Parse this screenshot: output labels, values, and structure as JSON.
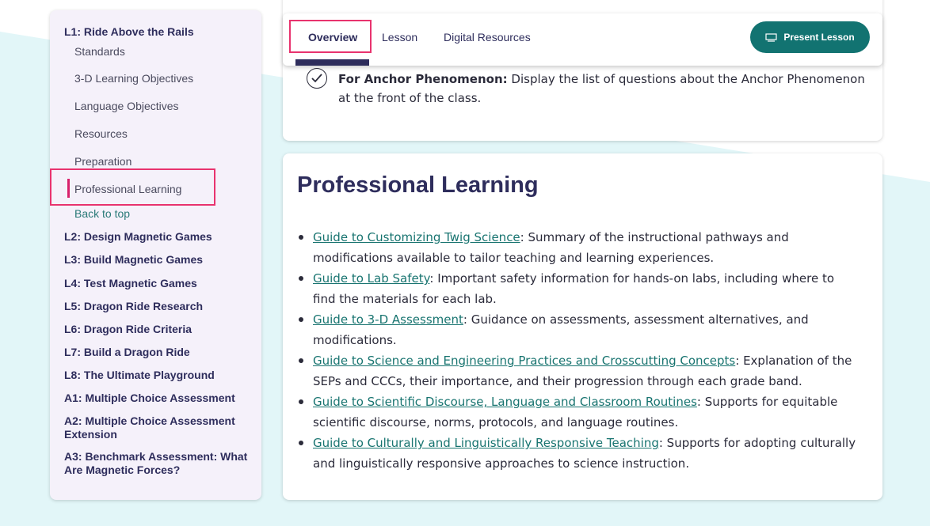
{
  "sidebar": {
    "top_item": "L1: Ride Above the Rails",
    "sub_items": [
      {
        "label": "Standards"
      },
      {
        "label": "3-D Learning Objectives"
      },
      {
        "label": "Language Objectives"
      },
      {
        "label": "Resources"
      },
      {
        "label": "Preparation"
      },
      {
        "label": "Professional Learning"
      }
    ],
    "back_to_top": "Back to top",
    "lessons": [
      {
        "label": "L2: Design Magnetic Games"
      },
      {
        "label": "L3: Build Magnetic Games"
      },
      {
        "label": "L4: Test Magnetic Games"
      },
      {
        "label": "L5: Dragon Ride Research"
      },
      {
        "label": "L6: Dragon Ride Criteria"
      },
      {
        "label": "L7: Build a Dragon Ride"
      },
      {
        "label": "L8: The Ultimate Playground"
      },
      {
        "label": "A1: Multiple Choice Assessment"
      },
      {
        "label": "A2: Multiple Choice Assessment Extension"
      },
      {
        "label": "A3: Benchmark Assessment: What Are Magnetic Forces?"
      }
    ]
  },
  "tabs": {
    "overview": "Overview",
    "lesson": "Lesson",
    "digital_resources": "Digital Resources",
    "present_button": "Present Lesson"
  },
  "anchor": {
    "bold": "For Anchor Phenomenon:",
    "text": " Display the list of questions about the Anchor Phenomenon at the front of the class."
  },
  "professional_learning": {
    "title": "Professional Learning",
    "items": [
      {
        "link": "Guide to Customizing Twig Science",
        "text": ": Summary of the instructional pathways and modifications available to tailor teaching and learning experiences."
      },
      {
        "link": "Guide to Lab Safety",
        "text": ": Important safety information for hands-on labs, including where to find the materials for each lab."
      },
      {
        "link": "Guide to 3-D Assessment",
        "text": ": Guidance on assessments, assessment alternatives, and modifications."
      },
      {
        "link": "Guide to Science and Engineering Practices and Crosscutting Concepts",
        "text": ": Explanation of the SEPs and CCCs, their importance, and their progression through each grade band."
      },
      {
        "link": "Guide to Scientific Discourse, Language and Classroom Routines",
        "text": ": Supports for equitable scientific discourse, norms, protocols, and language routines."
      },
      {
        "link": "Guide to Culturally and Linguistically Responsive Teaching",
        "text": ": Supports for adopting culturally and linguistically responsive approaches to science instruction."
      }
    ]
  },
  "colors": {
    "accent_teal": "#127371",
    "navy": "#2e2d5c",
    "highlight_pink": "#e8336e",
    "background_band": "#e2f6f8"
  }
}
